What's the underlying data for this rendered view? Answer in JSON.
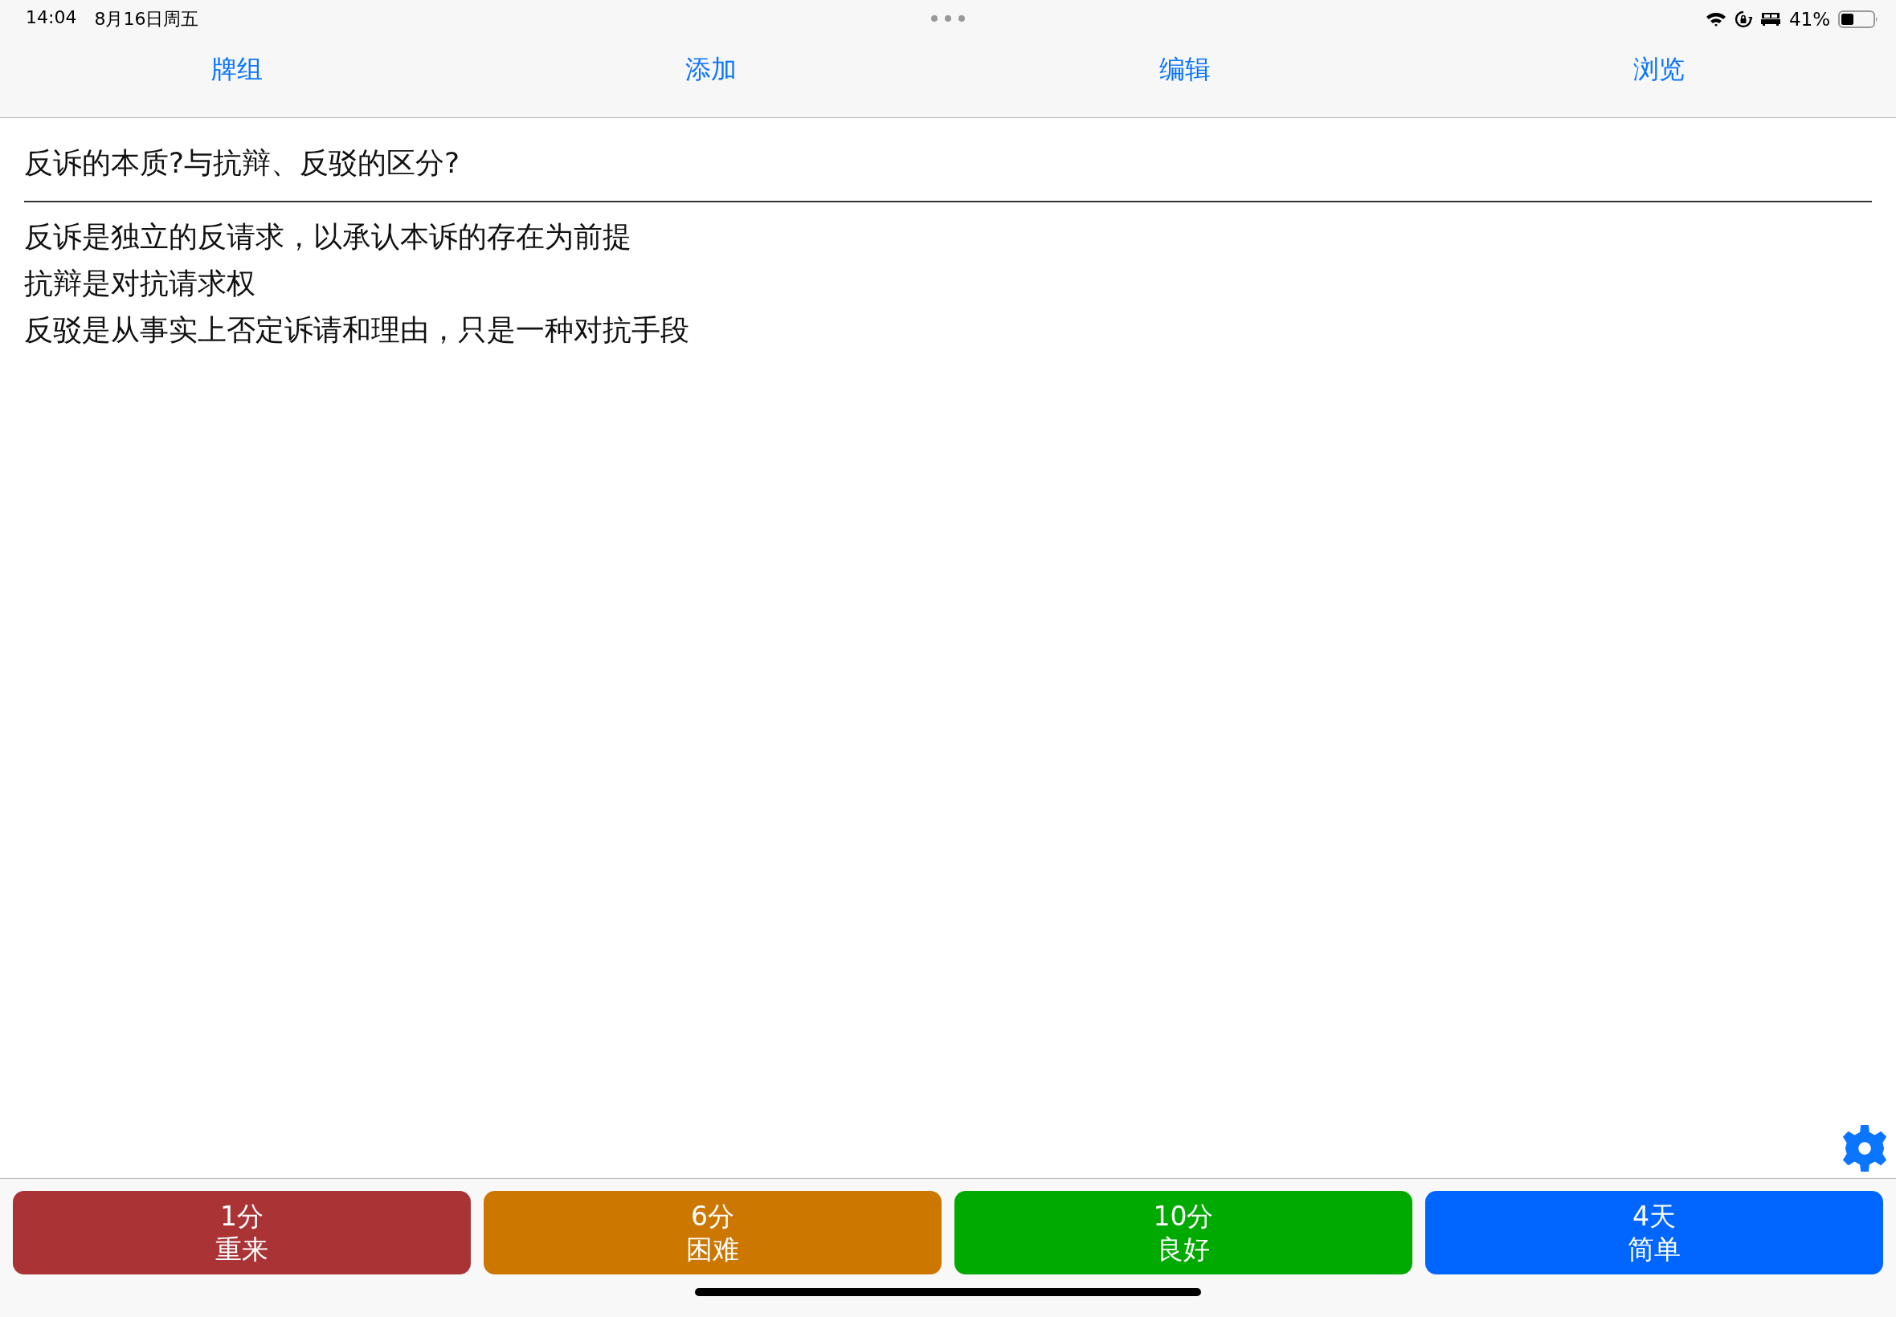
{
  "status_bar": {
    "time": "14:04",
    "date": "8月16日周五",
    "battery": "41%"
  },
  "tabs": [
    {
      "label": "牌组"
    },
    {
      "label": "添加"
    },
    {
      "label": "编辑"
    },
    {
      "label": "浏览"
    }
  ],
  "card": {
    "question": "反诉的本质?与抗辩、反驳的区分?",
    "answer_lines": [
      "反诉是独立的反请求，以承认本诉的存在为前提",
      "抗辩是对抗请求权",
      "反驳是从事实上否定诉请和理由，只是一种对抗手段"
    ]
  },
  "answer_buttons": [
    {
      "interval": "1分",
      "label": "重来",
      "color": "#a93335"
    },
    {
      "interval": "6分",
      "label": "困难",
      "color": "#cc7700"
    },
    {
      "interval": "10分",
      "label": "良好",
      "color": "#00aa00"
    },
    {
      "interval": "4天",
      "label": "简单",
      "color": "#0066ff"
    }
  ]
}
